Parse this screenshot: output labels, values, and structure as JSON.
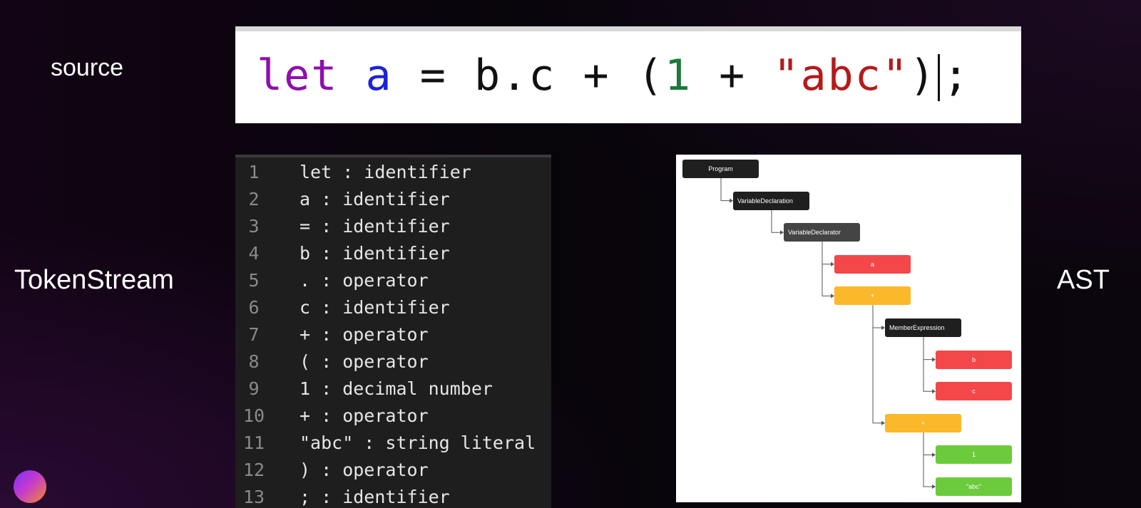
{
  "labels": {
    "source": "source",
    "token_stream": "TokenStream",
    "ast": "AST"
  },
  "source_code": {
    "tokens": [
      {
        "text": "let",
        "kind": "kw"
      },
      {
        "text": " ",
        "kind": "plain"
      },
      {
        "text": "a",
        "kind": "id"
      },
      {
        "text": " = b.c + (",
        "kind": "plain"
      },
      {
        "text": "1",
        "kind": "num"
      },
      {
        "text": " + ",
        "kind": "plain"
      },
      {
        "text": "\"abc\"",
        "kind": "str"
      },
      {
        "text": ")",
        "kind": "plain"
      },
      {
        "text": ";",
        "kind": "plain"
      }
    ]
  },
  "token_stream": [
    {
      "num": "1",
      "text": "let : identifier"
    },
    {
      "num": "2",
      "text": "a : identifier"
    },
    {
      "num": "3",
      "text": "= : identifier"
    },
    {
      "num": "4",
      "text": "b : identifier"
    },
    {
      "num": "5",
      "text": ". : operator"
    },
    {
      "num": "6",
      "text": "c : identifier"
    },
    {
      "num": "7",
      "text": "+ : operator"
    },
    {
      "num": "8",
      "text": "( : operator"
    },
    {
      "num": "9",
      "text": "1 : decimal number"
    },
    {
      "num": "10",
      "text": "+ : operator"
    },
    {
      "num": "11",
      "text": "\"abc\" : string literal"
    },
    {
      "num": "12",
      "text": ") : operator"
    },
    {
      "num": "13",
      "text": "; : identifier"
    }
  ],
  "ast": {
    "colors": {
      "node_dark": "#1f1f1f",
      "node_gray": "#444444",
      "node_red": "#f4474a",
      "node_orange": "#fbb82a",
      "node_green": "#6ccb3c",
      "line": "#555555"
    },
    "nodes": [
      {
        "id": "program",
        "label": "Program",
        "color": "node_dark",
        "style": "center",
        "parent": null
      },
      {
        "id": "vardecl",
        "label": "VariableDeclaration",
        "color": "node_dark",
        "style": "multi",
        "parent": "program"
      },
      {
        "id": "vardeclor",
        "label": "VariableDeclarator",
        "color": "node_gray",
        "style": "multi",
        "parent": "vardecl"
      },
      {
        "id": "a",
        "label": "a",
        "color": "node_red",
        "style": "center",
        "parent": "vardeclor"
      },
      {
        "id": "plus1",
        "label": "+",
        "color": "node_orange",
        "style": "center",
        "parent": "vardeclor"
      },
      {
        "id": "member",
        "label": "MemberExpression",
        "color": "node_dark",
        "style": "multi",
        "parent": "plus1"
      },
      {
        "id": "b",
        "label": "b",
        "color": "node_red",
        "style": "center",
        "parent": "member"
      },
      {
        "id": "c",
        "label": "c",
        "color": "node_red",
        "style": "center",
        "parent": "member"
      },
      {
        "id": "plus2",
        "label": "+",
        "color": "node_orange",
        "style": "center",
        "parent": "plus1"
      },
      {
        "id": "one",
        "label": "1",
        "color": "node_green",
        "style": "center",
        "parent": "plus2"
      },
      {
        "id": "abc",
        "label": "\"abc\"",
        "color": "node_green",
        "style": "center",
        "parent": "plus2"
      }
    ]
  }
}
